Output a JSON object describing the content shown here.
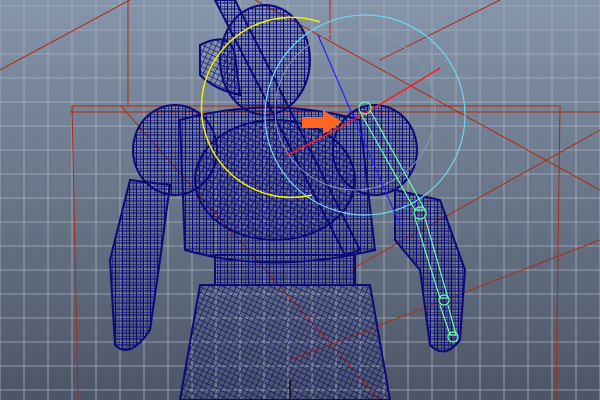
{
  "viewport": {
    "colors": {
      "bg_top": "#8595ab",
      "bg_bottom": "#4c5566",
      "grid": "#a7b0bd",
      "mesh": "#0a0a78",
      "bounding_box": "#b02a10",
      "rotate_outer": "#6fd6f0",
      "rotate_yellow": "#f0f000",
      "rotate_red": "#ff1a1a",
      "joint_chain": "#66ffaa",
      "arrow": "#ff6622"
    },
    "icons": [
      "orange-arrow-icon",
      "rotate-manipulator-icon"
    ]
  }
}
